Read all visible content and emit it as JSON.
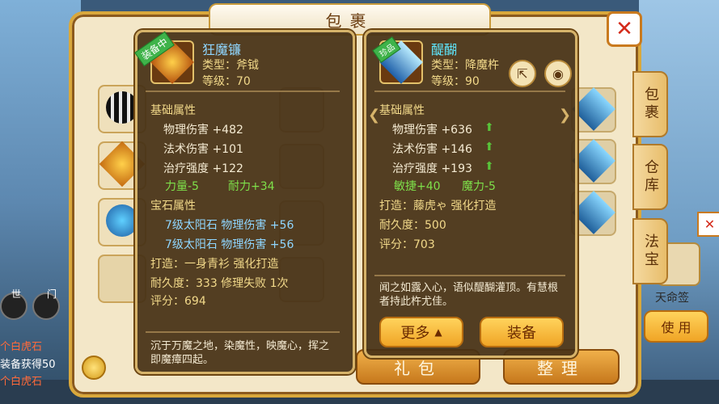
{
  "window": {
    "title": "包裹"
  },
  "tabs": [
    {
      "label": "包裹"
    },
    {
      "label": "仓库"
    },
    {
      "label": "法宝"
    }
  ],
  "bottom_buttons": {
    "gift": "礼包",
    "sort": "整理"
  },
  "equipped_item": {
    "badge": "装备中",
    "name": "狂魔镰",
    "type": "类型：斧钺",
    "level": "等级：70",
    "base_header": "基础属性",
    "base_stats": [
      "物理伤害 +482",
      "法术伤害 +101",
      "治疗强度 +122"
    ],
    "extra_stat_1": "力量-5",
    "extra_stat_2": "耐力+34",
    "gem_header": "宝石属性",
    "gems": [
      "7级太阳石  物理伤害  +56",
      "7级太阳石  物理伤害  +56"
    ],
    "forge": "打造：一身青衫   强化打造",
    "durability": "耐久度：333  修理失败  1次",
    "score": "评分：694",
    "description": "沉于万魔之地，染魔性，映魔心，挥之即魔瘴四起。"
  },
  "compare_item": {
    "badge": "珍品",
    "name": "醍醐",
    "type": "类型：降魔杵",
    "level": "等级：90",
    "base_header": "基础属性",
    "base_stats": [
      "物理伤害 +636",
      "法术伤害 +146",
      "治疗强度 +193"
    ],
    "extra_stat_1": "敏捷+40",
    "extra_stat_2": "魔力-5",
    "forge": "打造：藤虎ゃ   强化打造",
    "durability": "耐久度：500",
    "score": "评分：703",
    "description": "闻之如露入心，语似醍醐灌顶。有慧根者持此杵尤佳。",
    "more_label": "更多",
    "equip_label": "装备"
  },
  "background": {
    "chat_lines": [
      "个白虎石",
      "装备获得50",
      "个白虎石"
    ],
    "chat_label_1": "世",
    "chat_label_2": "门",
    "right_item_label": "天命签",
    "use_button": "使 用"
  },
  "colors": {
    "accent": "#f0a526",
    "panel": "#46301a",
    "frame": "#f3e7c8",
    "stat_green": "#7ee04a",
    "gem_blue": "#8fd6ff"
  }
}
